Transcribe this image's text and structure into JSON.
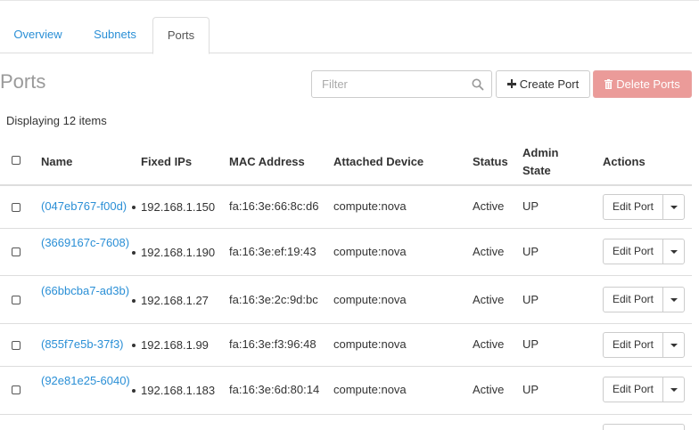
{
  "tabs": [
    {
      "label": "Overview"
    },
    {
      "label": "Subnets"
    },
    {
      "label": "Ports"
    }
  ],
  "page_title": "Ports",
  "filter": {
    "placeholder": "Filter",
    "value": ""
  },
  "actions": {
    "create_label": "Create Port",
    "delete_label": "Delete Ports"
  },
  "count_text": "Displaying 12 items",
  "columns": {
    "name": "Name",
    "fixed_ips": "Fixed IPs",
    "mac": "MAC Address",
    "device": "Attached Device",
    "status": "Status",
    "admin_state": "Admin State",
    "actions": "Actions"
  },
  "rows": [
    {
      "name": "(047eb767-f00d)",
      "ip": "192.168.1.150",
      "mac": "fa:16:3e:66:8c:d6",
      "device": "compute:nova",
      "status": "Active",
      "admin": "UP",
      "action": "Edit Port"
    },
    {
      "name": "(3669167c-7608)",
      "ip": "192.168.1.190",
      "mac": "fa:16:3e:ef:19:43",
      "device": "compute:nova",
      "status": "Active",
      "admin": "UP",
      "action": "Edit Port"
    },
    {
      "name": "(66bbcba7-ad3b)",
      "ip": "192.168.1.27",
      "mac": "fa:16:3e:2c:9d:bc",
      "device": "compute:nova",
      "status": "Active",
      "admin": "UP",
      "action": "Edit Port"
    },
    {
      "name": "(855f7e5b-37f3)",
      "ip": "192.168.1.99",
      "mac": "fa:16:3e:f3:96:48",
      "device": "compute:nova",
      "status": "Active",
      "admin": "UP",
      "action": "Edit Port"
    },
    {
      "name": "(92e81e25-6040)",
      "ip": "192.168.1.183",
      "mac": "fa:16:3e:6d:80:14",
      "device": "compute:nova",
      "status": "Active",
      "admin": "UP",
      "action": "Edit Port"
    }
  ],
  "colors": {
    "link": "#2a8fd6",
    "danger": "#eb9b99"
  }
}
